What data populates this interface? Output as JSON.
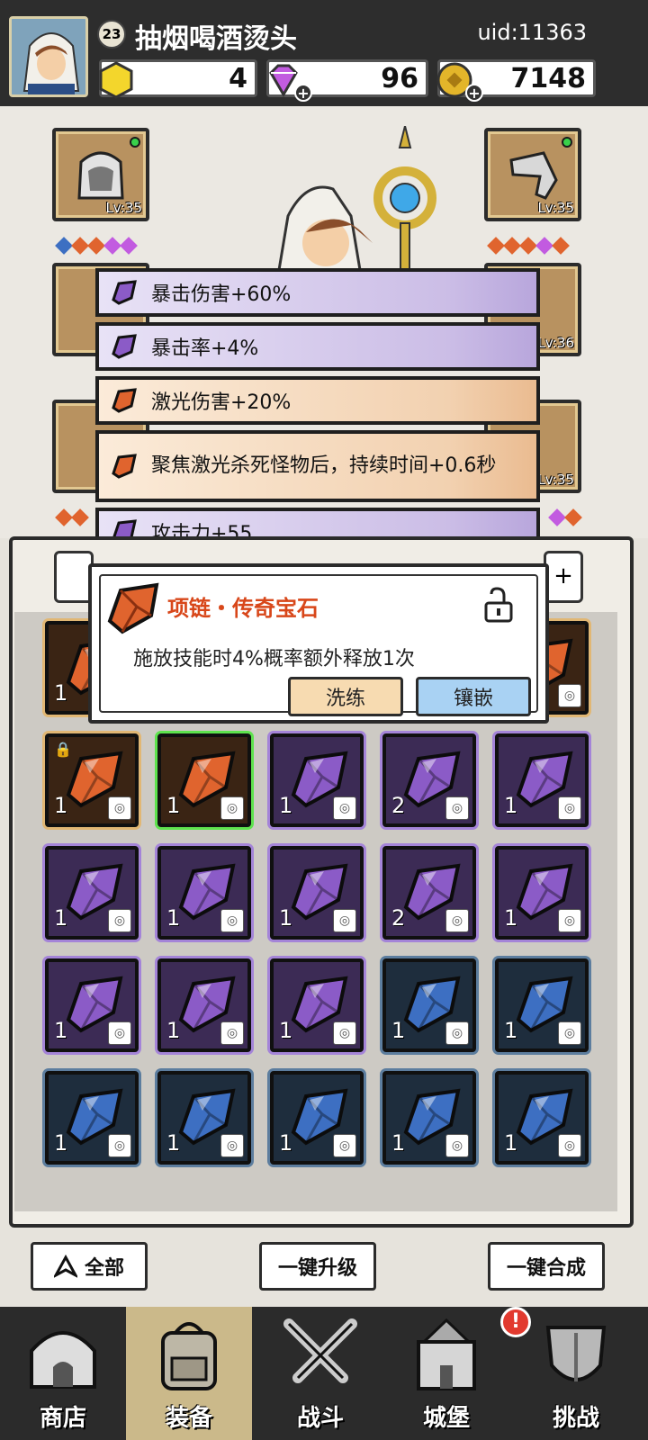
{
  "header": {
    "level": "23",
    "player_name": "抽烟喝酒烫头",
    "uid": "uid:11363",
    "gold_gem": "4",
    "diamond": "96",
    "coin": "7148"
  },
  "equip_slots": [
    {
      "lv": "Lv:35"
    },
    {
      "lv": "Lv:35"
    },
    {
      "lv": "Lv:36"
    },
    {
      "lv": "Lv:35"
    }
  ],
  "stats": [
    {
      "text": "暴击伤害+60%",
      "color": "purple"
    },
    {
      "text": "暴击率+4%",
      "color": "purple"
    },
    {
      "text": "激光伤害+20%",
      "color": "orange"
    },
    {
      "text": "聚焦激光杀死怪物后，持续时间+0.6秒",
      "color": "orange"
    },
    {
      "text": "攻击力+55",
      "color": "purple"
    }
  ],
  "popup": {
    "title": "项链・传奇宝石",
    "description": "施放技能时4%概率额外释放1次",
    "refine_label": "洗练",
    "inlay_label": "镶嵌"
  },
  "inventory": [
    {
      "count": "1",
      "color": "orange"
    },
    {
      "count": "1",
      "color": "orange"
    },
    {
      "count": "1",
      "color": "orange",
      "locked": true
    },
    {
      "count": "1",
      "color": "orange",
      "selected": true
    },
    {
      "count": "1",
      "color": "purple"
    },
    {
      "count": "2",
      "color": "purple"
    },
    {
      "count": "1",
      "color": "purple"
    },
    {
      "count": "1",
      "color": "purple"
    },
    {
      "count": "1",
      "color": "purple"
    },
    {
      "count": "1",
      "color": "purple"
    },
    {
      "count": "2",
      "color": "purple"
    },
    {
      "count": "1",
      "color": "purple"
    },
    {
      "count": "1",
      "color": "purple"
    },
    {
      "count": "1",
      "color": "purple"
    },
    {
      "count": "1",
      "color": "purple"
    },
    {
      "count": "1",
      "color": "blue"
    },
    {
      "count": "1",
      "color": "blue"
    },
    {
      "count": "1",
      "color": "blue"
    },
    {
      "count": "1",
      "color": "blue"
    },
    {
      "count": "1",
      "color": "blue"
    },
    {
      "count": "1",
      "color": "blue"
    },
    {
      "count": "1",
      "color": "blue"
    }
  ],
  "bottom_actions": {
    "all_label": "全部",
    "upgrade_all_label": "一键升级",
    "merge_all_label": "一键合成"
  },
  "nav": {
    "shop": "商店",
    "equip": "装备",
    "battle": "战斗",
    "castle": "城堡",
    "challenge": "挑战",
    "badge": "!"
  },
  "colors": {
    "orange_gem": "#e0642e",
    "purple_gem": "#8b5bc7",
    "blue_gem": "#3d6fc2",
    "title_red": "#d8471a"
  }
}
